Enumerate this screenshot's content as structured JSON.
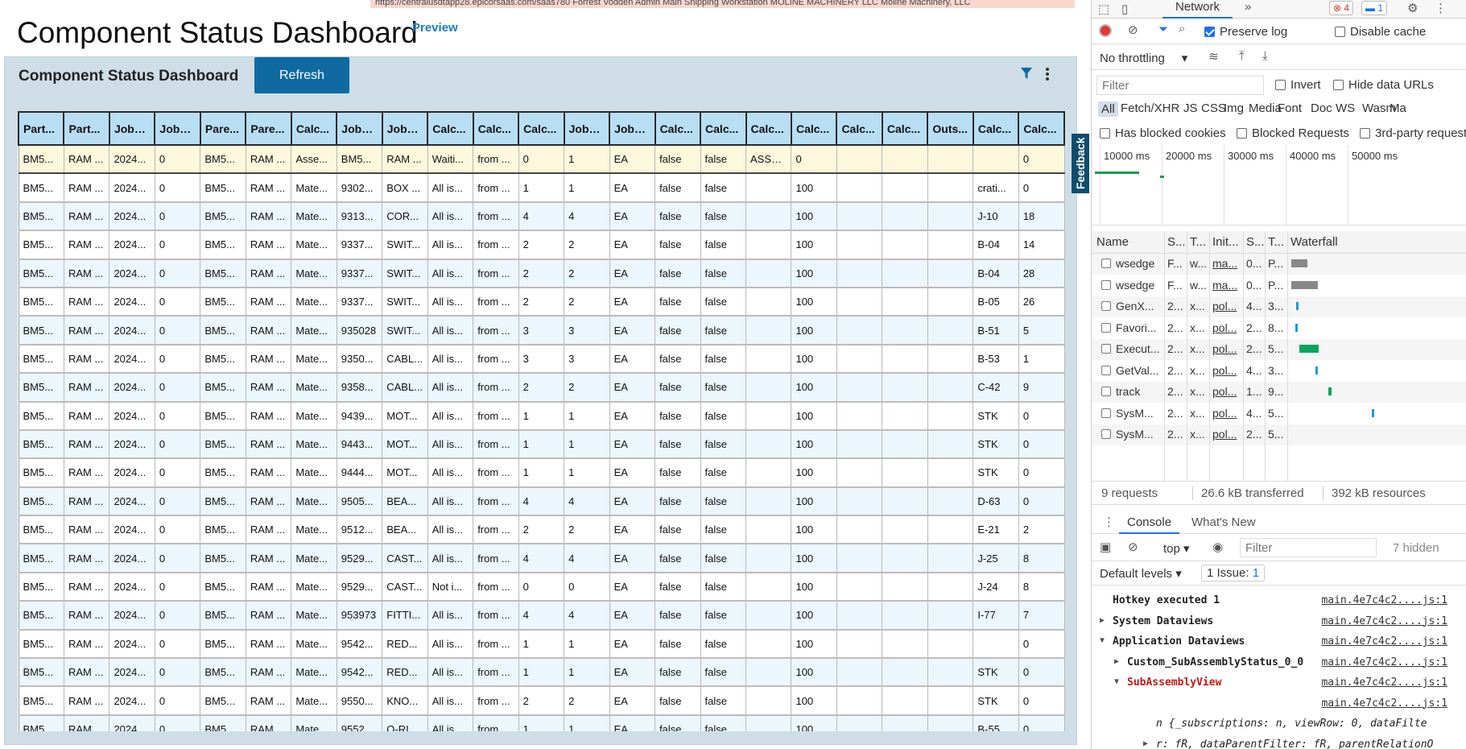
{
  "app": {
    "topbar_text": "https://centralusdtapp28.epicorsaas.com/saas780   Forrest Vodden Admin   Main Shipping Workstation   MOLINE MACHINERY LLC   Moline Machinery, LLC",
    "page_title": "Component Status Dashboard",
    "preview_label": "Preview",
    "panel_title": "Component Status Dashboard",
    "refresh_label": "Refresh",
    "feedback_label": "Feedback",
    "columns": [
      "Part...",
      "Part...",
      "JobA...",
      "JobA...",
      "Pare...",
      "Pare...",
      "Calc...",
      "JobA...",
      "JobA...",
      "Calc...",
      "Calc...",
      "Calc...",
      "JobA...",
      "JobA...",
      "Calc...",
      "Calc...",
      "Calc...",
      "Calc...",
      "Calc...",
      "Calc...",
      "Outs...",
      "Calc...",
      "Calc..."
    ],
    "rows": [
      [
        "BM5...",
        "RAM ...",
        "2024...",
        "0",
        "BM5...",
        "RAM ...",
        "Asse...",
        "BM5...",
        "RAM ...",
        "Waiti...",
        "from ...",
        "0",
        "1",
        "EA",
        "false",
        "false",
        "ASSE...",
        "0",
        "",
        "",
        "",
        "",
        "0"
      ],
      [
        "BM5...",
        "RAM ...",
        "2024...",
        "0",
        "BM5...",
        "RAM ...",
        "Mate...",
        "9302...",
        "BOX ...",
        "All is...",
        "from ...",
        "1",
        "1",
        "EA",
        "false",
        "false",
        "",
        "100",
        "",
        "",
        "",
        "crati...",
        "0"
      ],
      [
        "BM5...",
        "RAM ...",
        "2024...",
        "0",
        "BM5...",
        "RAM ...",
        "Mate...",
        "9313...",
        "COR...",
        "All is...",
        "from ...",
        "4",
        "4",
        "EA",
        "false",
        "false",
        "",
        "100",
        "",
        "",
        "",
        "J-10",
        "18"
      ],
      [
        "BM5...",
        "RAM ...",
        "2024...",
        "0",
        "BM5...",
        "RAM ...",
        "Mate...",
        "9337...",
        "SWIT...",
        "All is...",
        "from ...",
        "2",
        "2",
        "EA",
        "false",
        "false",
        "",
        "100",
        "",
        "",
        "",
        "B-04",
        "14"
      ],
      [
        "BM5...",
        "RAM ...",
        "2024...",
        "0",
        "BM5...",
        "RAM ...",
        "Mate...",
        "9337...",
        "SWIT...",
        "All is...",
        "from ...",
        "2",
        "2",
        "EA",
        "false",
        "false",
        "",
        "100",
        "",
        "",
        "",
        "B-04",
        "28"
      ],
      [
        "BM5...",
        "RAM ...",
        "2024...",
        "0",
        "BM5...",
        "RAM ...",
        "Mate...",
        "9337...",
        "SWIT...",
        "All is...",
        "from ...",
        "2",
        "2",
        "EA",
        "false",
        "false",
        "",
        "100",
        "",
        "",
        "",
        "B-05",
        "26"
      ],
      [
        "BM5...",
        "RAM ...",
        "2024...",
        "0",
        "BM5...",
        "RAM ...",
        "Mate...",
        "935028",
        "SWIT...",
        "All is...",
        "from ...",
        "3",
        "3",
        "EA",
        "false",
        "false",
        "",
        "100",
        "",
        "",
        "",
        "B-51",
        "5"
      ],
      [
        "BM5...",
        "RAM ...",
        "2024...",
        "0",
        "BM5...",
        "RAM ...",
        "Mate...",
        "9350...",
        "CABL...",
        "All is...",
        "from ...",
        "3",
        "3",
        "EA",
        "false",
        "false",
        "",
        "100",
        "",
        "",
        "",
        "B-53",
        "1"
      ],
      [
        "BM5...",
        "RAM ...",
        "2024...",
        "0",
        "BM5...",
        "RAM ...",
        "Mate...",
        "9358...",
        "CABL...",
        "All is...",
        "from ...",
        "2",
        "2",
        "EA",
        "false",
        "false",
        "",
        "100",
        "",
        "",
        "",
        "C-42",
        "9"
      ],
      [
        "BM5...",
        "RAM ...",
        "2024...",
        "0",
        "BM5...",
        "RAM ...",
        "Mate...",
        "9439...",
        "MOT...",
        "All is...",
        "from ...",
        "1",
        "1",
        "EA",
        "false",
        "false",
        "",
        "100",
        "",
        "",
        "",
        "STK",
        "0"
      ],
      [
        "BM5...",
        "RAM ...",
        "2024...",
        "0",
        "BM5...",
        "RAM ...",
        "Mate...",
        "9443...",
        "MOT...",
        "All is...",
        "from ...",
        "1",
        "1",
        "EA",
        "false",
        "false",
        "",
        "100",
        "",
        "",
        "",
        "STK",
        "0"
      ],
      [
        "BM5...",
        "RAM ...",
        "2024...",
        "0",
        "BM5...",
        "RAM ...",
        "Mate...",
        "9444...",
        "MOT...",
        "All is...",
        "from ...",
        "1",
        "1",
        "EA",
        "false",
        "false",
        "",
        "100",
        "",
        "",
        "",
        "STK",
        "0"
      ],
      [
        "BM5...",
        "RAM ...",
        "2024...",
        "0",
        "BM5...",
        "RAM ...",
        "Mate...",
        "9505...",
        "BEA...",
        "All is...",
        "from ...",
        "4",
        "4",
        "EA",
        "false",
        "false",
        "",
        "100",
        "",
        "",
        "",
        "D-63",
        "0"
      ],
      [
        "BM5...",
        "RAM ...",
        "2024...",
        "0",
        "BM5...",
        "RAM ...",
        "Mate...",
        "9512...",
        "BEA...",
        "All is...",
        "from ...",
        "2",
        "2",
        "EA",
        "false",
        "false",
        "",
        "100",
        "",
        "",
        "",
        "E-21",
        "2"
      ],
      [
        "BM5...",
        "RAM ...",
        "2024...",
        "0",
        "BM5...",
        "RAM ...",
        "Mate...",
        "9529...",
        "CAST...",
        "All is...",
        "from ...",
        "4",
        "4",
        "EA",
        "false",
        "false",
        "",
        "100",
        "",
        "",
        "",
        "J-25",
        "8"
      ],
      [
        "BM5...",
        "RAM ...",
        "2024...",
        "0",
        "BM5...",
        "RAM ...",
        "Mate...",
        "9529...",
        "CAST...",
        "Not i...",
        "from ...",
        "0",
        "0",
        "EA",
        "false",
        "false",
        "",
        "100",
        "",
        "",
        "",
        "J-24",
        "8"
      ],
      [
        "BM5...",
        "RAM ...",
        "2024...",
        "0",
        "BM5...",
        "RAM ...",
        "Mate...",
        "953973",
        "FITTI...",
        "All is...",
        "from ...",
        "4",
        "4",
        "EA",
        "false",
        "false",
        "",
        "100",
        "",
        "",
        "",
        "I-77",
        "7"
      ],
      [
        "BM5...",
        "RAM ...",
        "2024...",
        "0",
        "BM5...",
        "RAM ...",
        "Mate...",
        "9542...",
        "RED...",
        "All is...",
        "from ...",
        "1",
        "1",
        "EA",
        "false",
        "false",
        "",
        "100",
        "",
        "",
        "",
        "",
        "0"
      ],
      [
        "BM5...",
        "RAM ...",
        "2024...",
        "0",
        "BM5...",
        "RAM ...",
        "Mate...",
        "9542...",
        "RED...",
        "All is...",
        "from ...",
        "1",
        "1",
        "EA",
        "false",
        "false",
        "",
        "100",
        "",
        "",
        "",
        "STK",
        "0"
      ],
      [
        "BM5...",
        "RAM ...",
        "2024...",
        "0",
        "BM5...",
        "RAM ...",
        "Mate...",
        "9550...",
        "KNO...",
        "All is...",
        "from ...",
        "2",
        "2",
        "EA",
        "false",
        "false",
        "",
        "100",
        "",
        "",
        "",
        "STK",
        "0"
      ],
      [
        "BM5...",
        "RAM ...",
        "2024...",
        "0",
        "BM5...",
        "RAM ...",
        "Mate...",
        "9552...",
        "O-RI...",
        "All is...",
        "from ...",
        "1",
        "1",
        "EA",
        "false",
        "false",
        "",
        "100",
        "",
        "",
        "",
        "B-55",
        "0"
      ]
    ]
  },
  "devtools": {
    "active_tab": "Network",
    "error_count": "4",
    "message_count": "1",
    "preserve_log": "Preserve log",
    "disable_cache": "Disable cache",
    "throttling": "No throttling",
    "filter_placeholder": "Filter",
    "invert": "Invert",
    "hide_data_urls": "Hide data URLs",
    "type_filters": [
      "All",
      "Fetch/XHR",
      "JS",
      "CSS",
      "Img",
      "Media",
      "Font",
      "Doc",
      "WS",
      "Wasm",
      "Ma"
    ],
    "has_blocked_cookies": "Has blocked cookies",
    "blocked_requests": "Blocked Requests",
    "third_party": "3rd-party request",
    "timeline_ticks": [
      "10000 ms",
      "20000 ms",
      "30000 ms",
      "40000 ms",
      "50000 ms"
    ],
    "columns": [
      "Name",
      "S...",
      "T...",
      "Init...",
      "S...",
      "T...",
      "Waterfall"
    ],
    "requests": [
      {
        "name": "wsedge",
        "status": "F...",
        "type": "w...",
        "initiator": "ma...",
        "size": "0...",
        "time": "P...",
        "wf_start": 0.0,
        "wf_len": 0.2,
        "wf_color": "#888888"
      },
      {
        "name": "wsedge",
        "status": "F...",
        "type": "w...",
        "initiator": "ma...",
        "size": "0...",
        "time": "P...",
        "wf_start": 0.0,
        "wf_len": 0.33,
        "wf_color": "#888888"
      },
      {
        "name": "GenX...",
        "status": "2...",
        "type": "x...",
        "initiator": "pol...",
        "size": "4...",
        "time": "3...",
        "wf_start": 0.06,
        "wf_len": 0.02,
        "wf_color": "#1a9bd7"
      },
      {
        "name": "Favori...",
        "status": "2...",
        "type": "x...",
        "initiator": "pol...",
        "size": "2...",
        "time": "8...",
        "wf_start": 0.05,
        "wf_len": 0.02,
        "wf_color": "#1a9bd7"
      },
      {
        "name": "Execut...",
        "status": "2...",
        "type": "x...",
        "initiator": "pol...",
        "size": "2...",
        "time": "5...",
        "wf_start": 0.1,
        "wf_len": 0.24,
        "wf_color": "#0aa55a"
      },
      {
        "name": "GetVal...",
        "status": "2...",
        "type": "x...",
        "initiator": "pol...",
        "size": "4...",
        "time": "3...",
        "wf_start": 0.3,
        "wf_len": 0.03,
        "wf_color": "#1a9bd7"
      },
      {
        "name": "track",
        "status": "2...",
        "type": "x...",
        "initiator": "pol...",
        "size": "1...",
        "time": "9...",
        "wf_start": 0.46,
        "wf_len": 0.04,
        "wf_color": "#0aa55a"
      },
      {
        "name": "SysM...",
        "status": "2...",
        "type": "x...",
        "initiator": "pol...",
        "size": "4...",
        "time": "5...",
        "wf_start": 1.0,
        "wf_len": 0.03,
        "wf_color": "#1a9bd7"
      },
      {
        "name": "SysM...",
        "status": "2...",
        "type": "x...",
        "initiator": "pol...",
        "size": "2...",
        "time": "5...",
        "wf_start": 0.0,
        "wf_len": 0.0,
        "wf_color": "#1a9bd7"
      }
    ],
    "summary": {
      "requests": "9 requests",
      "transferred": "26.6 kB transferred",
      "resources": "392 kB resources"
    },
    "console_tabs": [
      "Console",
      "What's New"
    ],
    "context": "top",
    "console_filter_placeholder": "Filter",
    "hidden_count": "7 hidden",
    "default_levels": "Default levels",
    "issues": "1 Issue:",
    "issues_count": "1",
    "console_lines": [
      {
        "text": "Hotkey executed 1",
        "src": "main.4e7c4c2....js:1",
        "indent": 0,
        "arrow": "",
        "color": "#222"
      },
      {
        "text": "System Dataviews",
        "src": "main.4e7c4c2....js:1",
        "indent": 0,
        "arrow": "▶",
        "color": "#222"
      },
      {
        "text": "Application Dataviews",
        "src": "main.4e7c4c2....js:1",
        "indent": 0,
        "arrow": "▼",
        "color": "#222"
      },
      {
        "text": "Custom_SubAssemblyStatus_0_0",
        "src": "main.4e7c4c2....js:1",
        "indent": 1,
        "arrow": "▶",
        "color": "#222"
      },
      {
        "text": "SubAssemblyView",
        "src": "main.4e7c4c2....js:1",
        "indent": 1,
        "arrow": "▼",
        "color": "#c41a16"
      },
      {
        "text": "",
        "src": "main.4e7c4c2....js:1",
        "indent": 2,
        "arrow": "",
        "color": "#222"
      },
      {
        "text": "n {_subscriptions: n, viewRow: 0, dataFilte",
        "src": "",
        "indent": 3,
        "arrow": "",
        "color": "#222"
      },
      {
        "text": "r: fR, dataParentFilter: fR, parentRelationO",
        "src": "",
        "indent": 3,
        "arrow": "▶",
        "color": "#222"
      }
    ]
  },
  "colors": {
    "accent": "#0f6aa1",
    "header": "#b8def4",
    "panel": "#cfdee6",
    "selected_row": "#fdf8dc"
  }
}
